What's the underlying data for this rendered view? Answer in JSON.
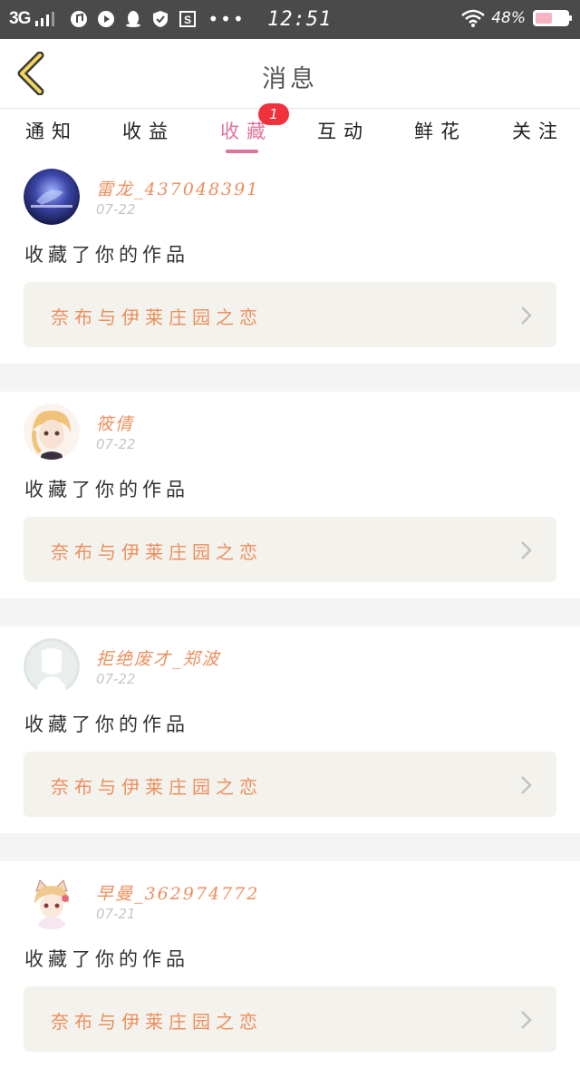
{
  "status_bar": {
    "network": "3G",
    "time": "12:51",
    "battery": "48%"
  },
  "header": {
    "title": "消息",
    "back_icon": "chevron-left-icon"
  },
  "tabs": [
    {
      "label": "通知",
      "active": false
    },
    {
      "label": "收益",
      "active": false
    },
    {
      "label": "收藏",
      "active": true
    },
    {
      "label": "互动",
      "active": false
    },
    {
      "label": "鲜花",
      "active": false
    },
    {
      "label": "关注",
      "active": false
    }
  ],
  "tab_badge": "1",
  "colors": {
    "accent": "#e0739e",
    "username": "#ec8f5e",
    "badge": "#f0323c",
    "work_bg": "#f3f2ec",
    "status_bar": "#4a4a4a"
  },
  "messages": [
    {
      "username": "雷龙_437048391",
      "date": "07-22",
      "action": "收藏了你的作品",
      "work_title": "奈布与伊莱庄园之恋"
    },
    {
      "username": "筱倩",
      "date": "07-22",
      "action": "收藏了你的作品",
      "work_title": "奈布与伊莱庄园之恋"
    },
    {
      "username": "拒绝废才_郑波",
      "date": "07-22",
      "action": "收藏了你的作品",
      "work_title": "奈布与伊莱庄园之恋"
    },
    {
      "username": "早曼_362974772",
      "date": "07-21",
      "action": "收藏了你的作品",
      "work_title": "奈布与伊莱庄园之恋"
    }
  ]
}
